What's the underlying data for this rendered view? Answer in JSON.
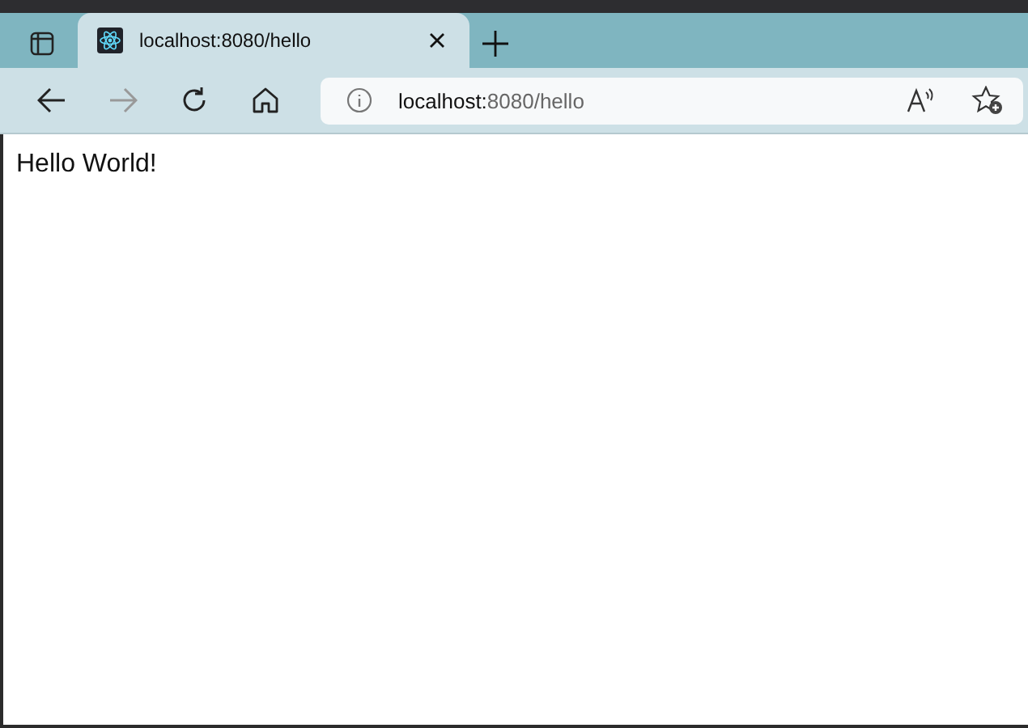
{
  "tab": {
    "title": "localhost:8080/hello",
    "selected": true
  },
  "address_bar": {
    "host": "localhost:",
    "path": "8080/hello"
  },
  "page": {
    "text": "Hello World!"
  }
}
